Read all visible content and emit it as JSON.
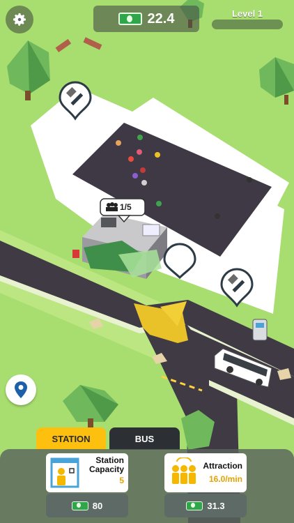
{
  "hud": {
    "money": "22.4",
    "level_label": "Level 1",
    "level_progress": 0.0
  },
  "station_popup": {
    "capacity_text": "1/5"
  },
  "tabs": {
    "station": "STATION",
    "bus": "BUS",
    "active": "station"
  },
  "upgrades": [
    {
      "title_line1": "Station",
      "title_line2": "Capacity",
      "value": "5",
      "cost": "80",
      "icon": "station-person-icon"
    },
    {
      "title_line1": "Attraction",
      "title_line2": "",
      "value": "16.0/min",
      "cost": "31.3",
      "icon": "people-group-icon"
    }
  ],
  "colors": {
    "grass": "#a8dd6f",
    "road": "#3f3a44",
    "accent_yellow": "#fec00f",
    "money_green": "#2fa64a"
  }
}
